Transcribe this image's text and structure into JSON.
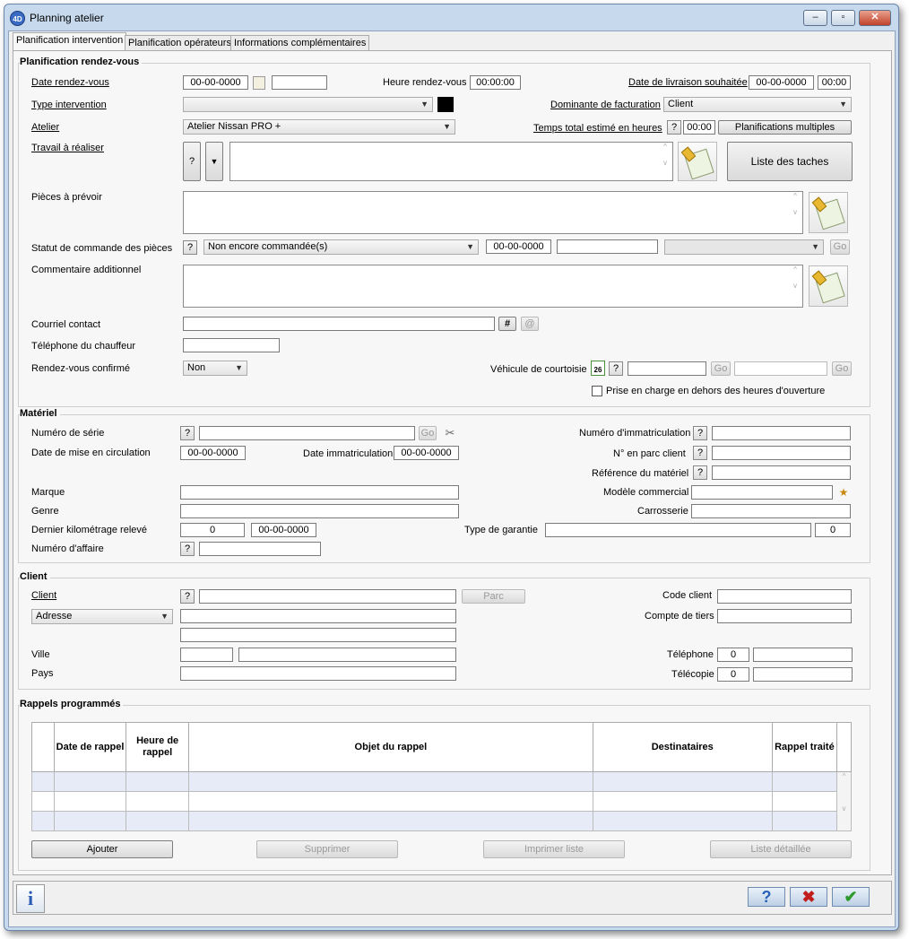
{
  "window": {
    "title": "Planning atelier",
    "app_badge": "4D",
    "min": "‒",
    "max": "▫",
    "close": "✕"
  },
  "tabs": [
    "Planification intervention",
    "Planification opérateurs",
    "Informations complémentaires"
  ],
  "rdv": {
    "title": "Planification rendez-vous",
    "date_label": "Date rendez-vous",
    "date_value": "00-00-0000",
    "heure_label": "Heure rendez-vous",
    "heure_value": "00:00:00",
    "livraison_label": "Date de livraison souhaitée",
    "livraison_date": "00-00-0000",
    "livraison_heure": "00:00",
    "type_label": "Type intervention",
    "dominante_label": "Dominante de facturation",
    "dominante_value": "Client",
    "atelier_label": "Atelier",
    "atelier_value": "Atelier Nissan PRO +",
    "temps_label": "Temps total estimé en heures",
    "temps_value": "00:00",
    "planif_multiples": "Planifications multiples",
    "travail_label": "Travail à réaliser",
    "liste_taches": "Liste des taches",
    "pieces_label": "Pièces à prévoir",
    "statut_label": "Statut de commande des pièces",
    "statut_value": "Non encore commandée(s)",
    "statut_date": "00-00-0000",
    "commentaire_label": "Commentaire additionnel",
    "courriel_label": "Courriel contact",
    "hash": "#",
    "at": "@",
    "telephone_label": "Téléphone du chauffeur",
    "confirme_label": "Rendez-vous confirmé",
    "confirme_value": "Non",
    "courtoisie_label": "Véhicule de courtoisie",
    "calendar_day": "26",
    "prise_label": "Prise en charge en dehors des heures d'ouverture",
    "go": "Go",
    "q": "?"
  },
  "materiel": {
    "title": "Matériel",
    "serie_label": "Numéro de série",
    "immat_label": "Numéro d'immatriculation",
    "circulation_label": "Date de mise en circulation",
    "circulation_value": "00-00-0000",
    "date_immat_label": "Date immatriculation",
    "date_immat_value": "00-00-0000",
    "parc_label": "N° en parc client",
    "ref_label": "Référence du matériel",
    "marque_label": "Marque",
    "modele_label": "Modèle commercial",
    "genre_label": "Genre",
    "carrosserie_label": "Carrosserie",
    "km_label": "Dernier kilométrage relevé",
    "km_value": "0",
    "km_date": "00-00-0000",
    "garantie_label": "Type de garantie",
    "garantie_value": "0",
    "affaire_label": "Numéro d'affaire"
  },
  "client": {
    "title": "Client",
    "client_label": "Client",
    "parc_btn": "Parc",
    "code_label": "Code client",
    "adresse_select": "Adresse",
    "tiers_label": "Compte de tiers",
    "ville_label": "Ville",
    "pays_label": "Pays",
    "tel_label": "Téléphone",
    "tel_value": "0",
    "fax_label": "Télécopie",
    "fax_value": "0"
  },
  "rappels": {
    "title": "Rappels programmés",
    "headers": [
      "Date de rappel",
      "Heure de rappel",
      "Objet du rappel",
      "Destinataires",
      "Rappel traité"
    ],
    "ajouter": "Ajouter",
    "supprimer": "Supprimer",
    "imprimer": "Imprimer liste",
    "liste": "Liste détaillée"
  },
  "footer": {
    "info": "i",
    "help": "?",
    "cancel": "✖",
    "ok": "✔"
  }
}
